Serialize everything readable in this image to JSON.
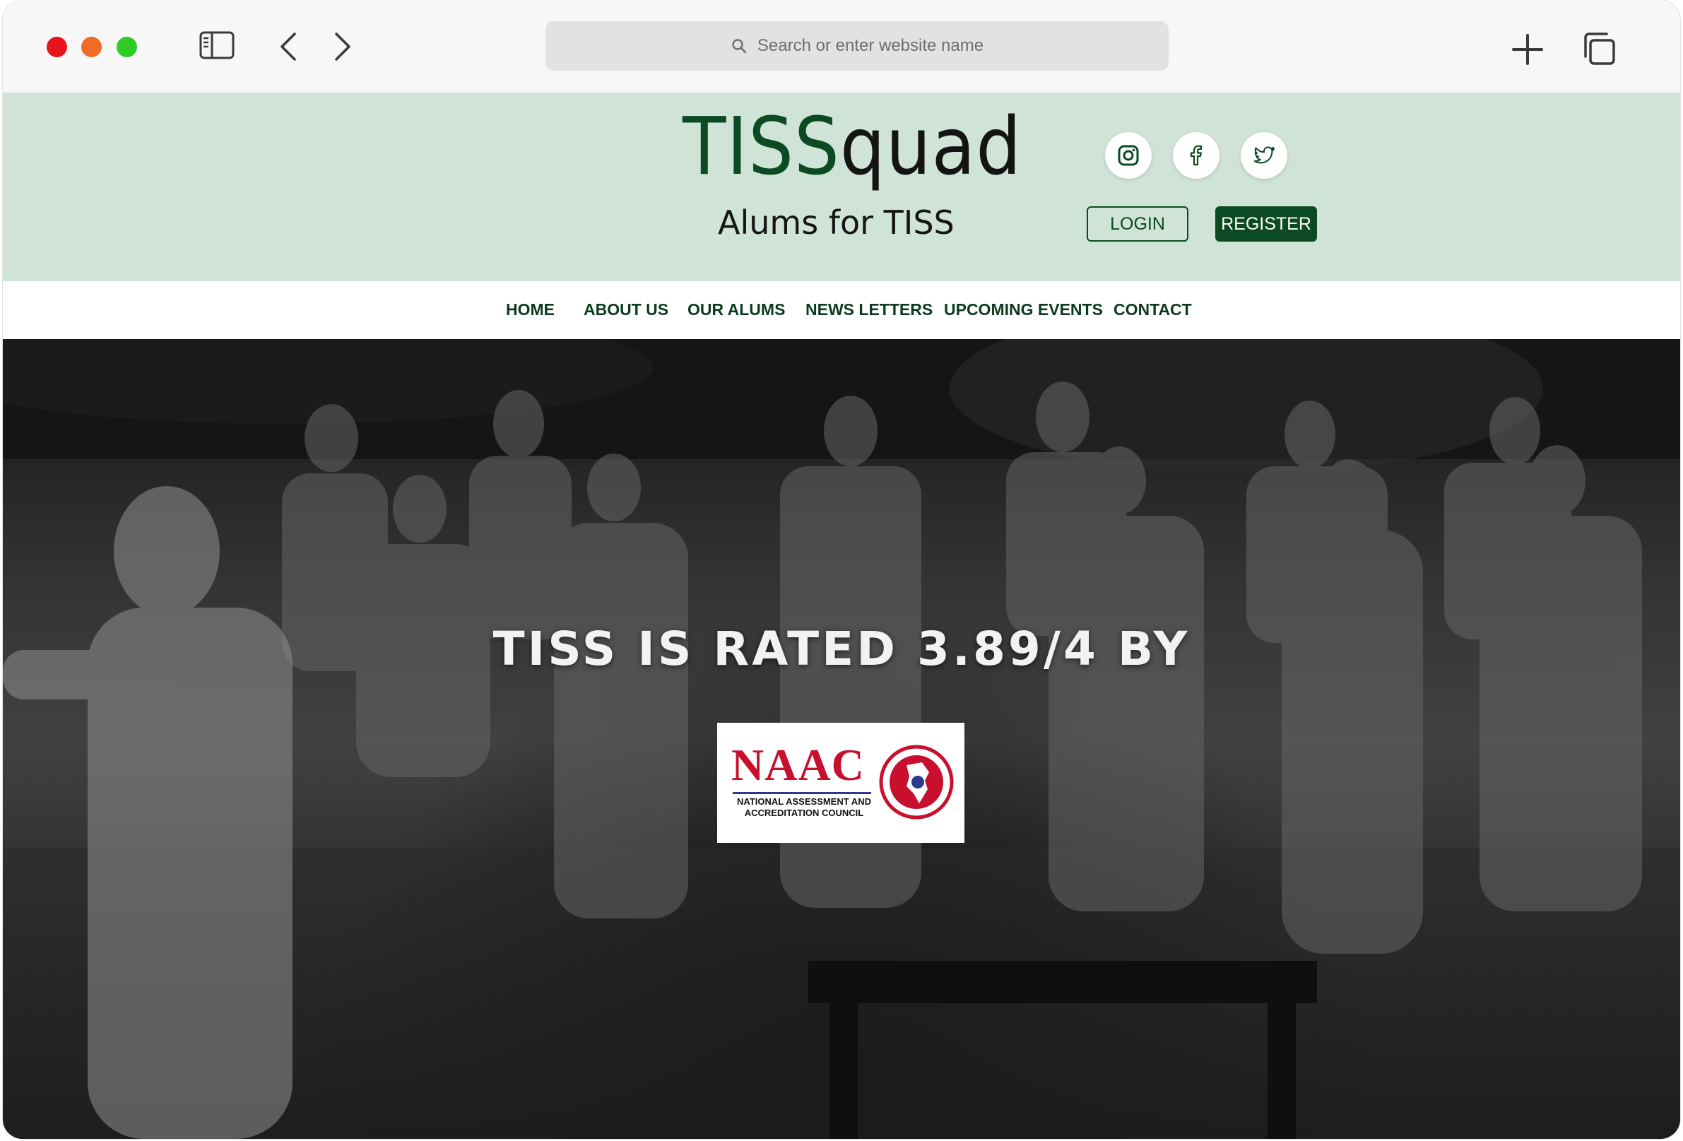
{
  "browser": {
    "address_placeholder": "Search or enter website name"
  },
  "header": {
    "logo_part1": "TISS",
    "logo_part2": "quad",
    "tagline": "Alums for TISS",
    "social": [
      "instagram-icon",
      "facebook-icon",
      "twitter-icon"
    ],
    "login_label": "LOGIN",
    "register_label": "REGISTER"
  },
  "nav": {
    "items": [
      "HOME",
      "ABOUT US",
      "OUR ALUMS",
      "NEWS LETTERS",
      "UPCOMING EVENTS",
      "CONTACT"
    ]
  },
  "hero": {
    "title": "TISS IS RATED 3.89/4 BY",
    "badge_title": "NAAC",
    "badge_subtitle": "NATIONAL ASSESSMENT AND ACCREDITATION COUNCIL"
  },
  "colors": {
    "brand_green": "#0b4a22",
    "header_bg": "#cfe3d6",
    "naac_red": "#c8102e"
  }
}
